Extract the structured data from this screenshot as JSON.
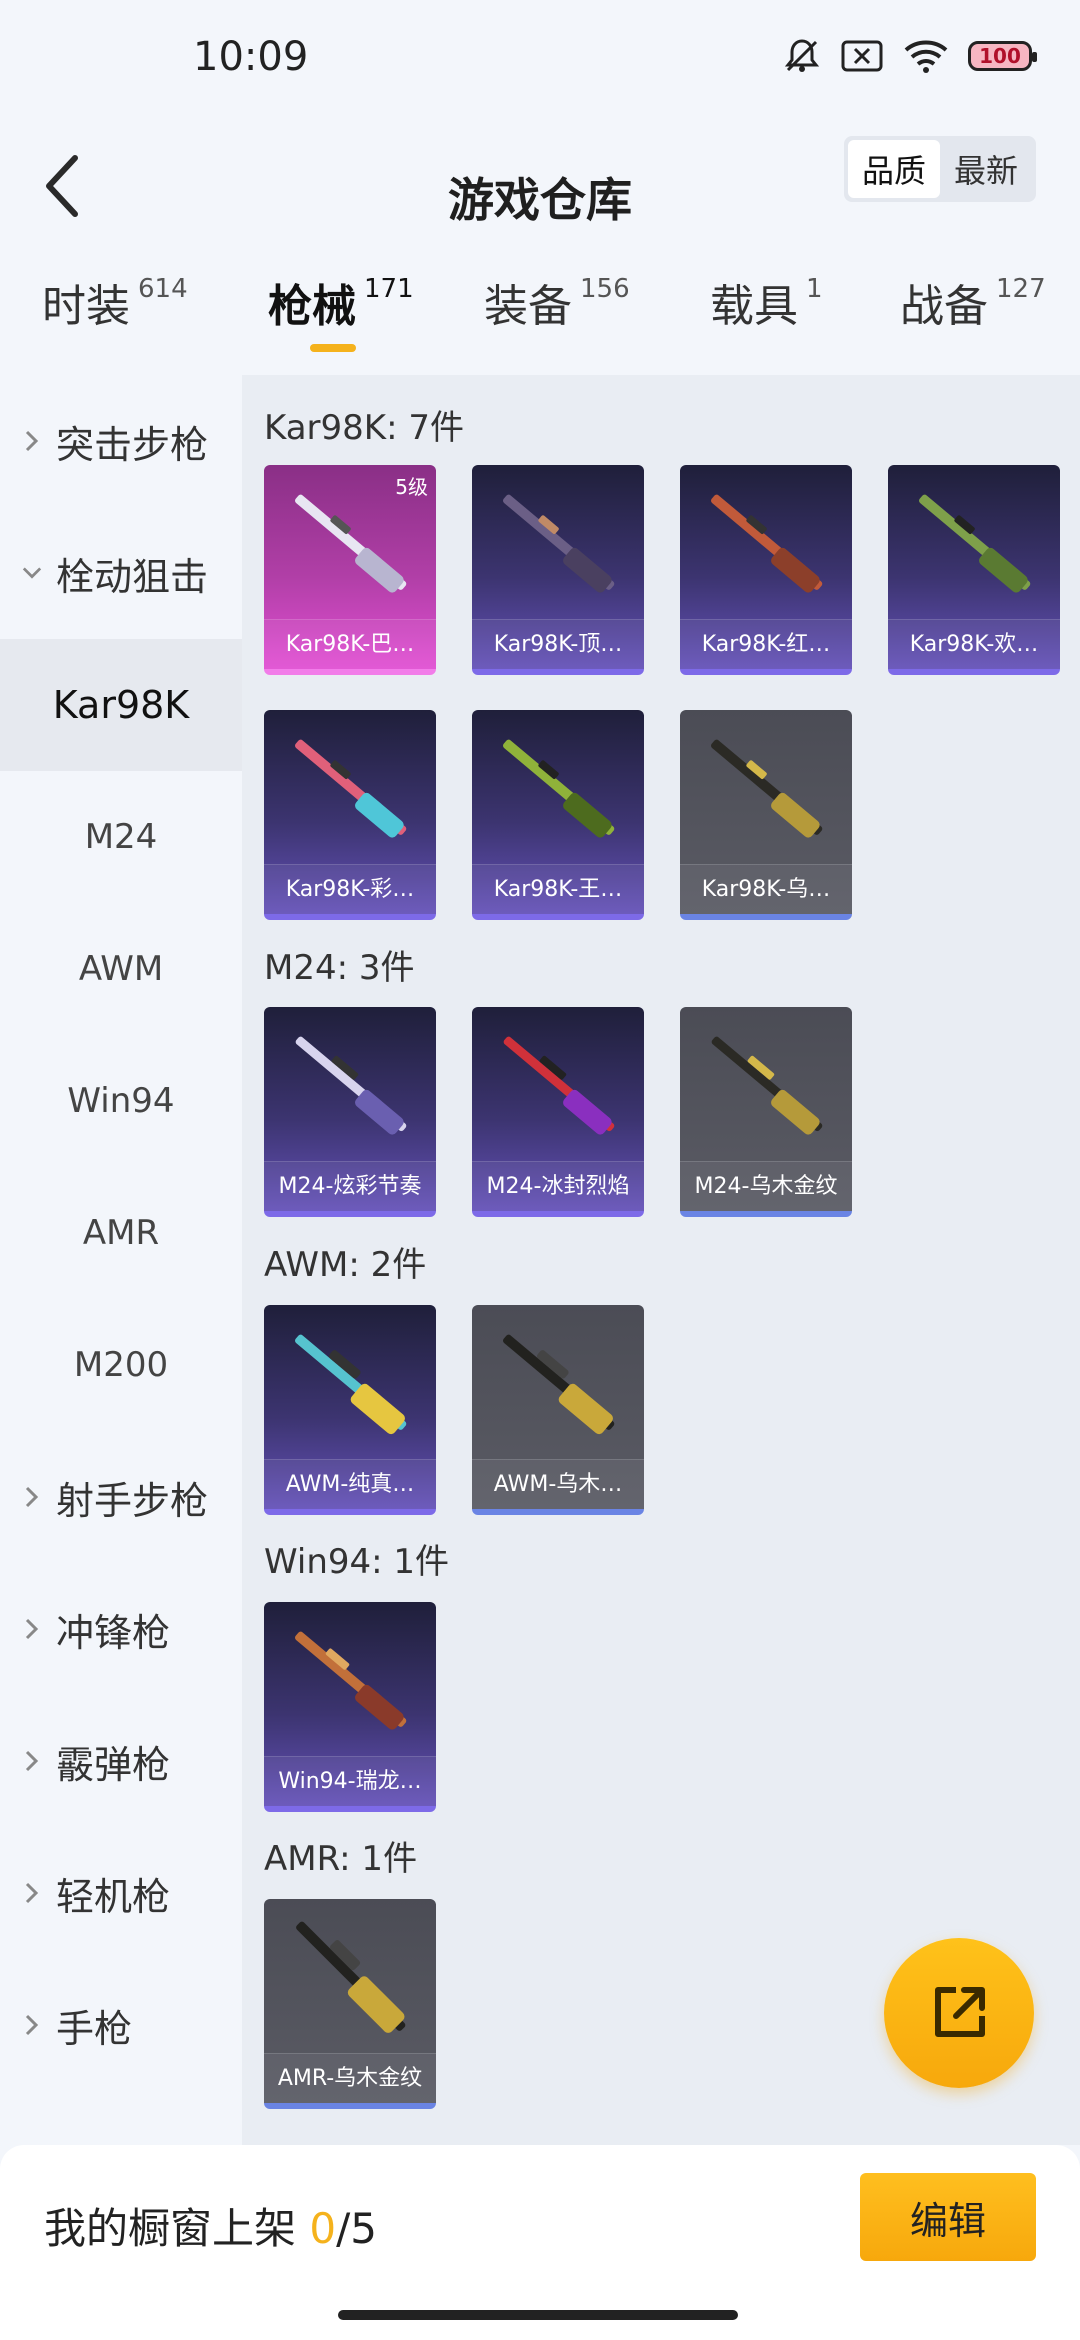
{
  "status_bar": {
    "time": "10:09",
    "battery": "100"
  },
  "header": {
    "title": "游戏仓库",
    "sort_options": [
      "品质",
      "最新"
    ]
  },
  "tabs": [
    {
      "label": "时装",
      "count": "614"
    },
    {
      "label": "枪械",
      "count": "171"
    },
    {
      "label": "装备",
      "count": "156"
    },
    {
      "label": "载具",
      "count": "1"
    },
    {
      "label": "战备",
      "count": "127"
    }
  ],
  "sidebar": {
    "categories": [
      "突击步枪",
      "栓动狙击",
      "射手步枪",
      "冲锋枪",
      "霰弹枪",
      "轻机枪",
      "手枪"
    ],
    "subitems": [
      "Kar98K",
      "M24",
      "AWM",
      "Win94",
      "AMR",
      "M200"
    ]
  },
  "sections": [
    {
      "title": "Kar98K: 7件",
      "items": [
        {
          "name": "Kar98K-巴…",
          "tier": "pink",
          "level": "5级"
        },
        {
          "name": "Kar98K-顶…",
          "tier": "purple"
        },
        {
          "name": "Kar98K-红…",
          "tier": "purple"
        },
        {
          "name": "Kar98K-欢…",
          "tier": "purple"
        },
        {
          "name": "Kar98K-彩…",
          "tier": "purple"
        },
        {
          "name": "Kar98K-王…",
          "tier": "purple"
        },
        {
          "name": "Kar98K-乌…",
          "tier": "gray"
        }
      ]
    },
    {
      "title": "M24: 3件",
      "items": [
        {
          "name": "M24-炫彩节奏",
          "tier": "purple"
        },
        {
          "name": "M24-冰封烈焰",
          "tier": "purple"
        },
        {
          "name": "M24-乌木金纹",
          "tier": "gray"
        }
      ]
    },
    {
      "title": "AWM: 2件",
      "items": [
        {
          "name": "AWM-纯真…",
          "tier": "purple"
        },
        {
          "name": "AWM-乌木…",
          "tier": "gray"
        }
      ]
    },
    {
      "title": "Win94: 1件",
      "items": [
        {
          "name": "Win94-瑞龙…",
          "tier": "purple"
        }
      ]
    },
    {
      "title": "AMR: 1件",
      "items": [
        {
          "name": "AMR-乌木金纹",
          "tier": "gray"
        }
      ]
    }
  ],
  "bottom_bar": {
    "label": "我的橱窗上架",
    "current": "0",
    "total": "/5",
    "edit": "编辑"
  }
}
